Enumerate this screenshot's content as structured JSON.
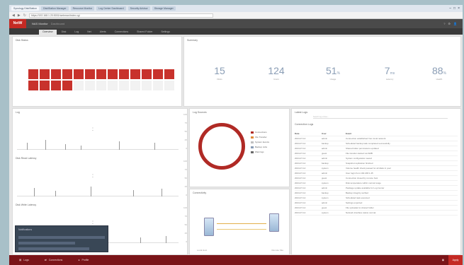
{
  "browser": {
    "tabs": [
      "Synology DiskStation",
      "DiskStation Manager",
      "Resource Monitor",
      "Log Center Dashboard",
      "Security Advisor",
      "Storage Manager"
    ],
    "url": "https://192.168.1.20:5001/webman/index.cgi",
    "controls": [
      "–",
      "□",
      "×"
    ]
  },
  "app": {
    "logo": "NetW",
    "title": "NAS Monitor",
    "subtitle": "Dashboard",
    "header_icons": [
      "?",
      "⚙",
      "👤"
    ],
    "nav_tabs": [
      "Overview",
      "Disk",
      "Log",
      "Net",
      "Alerts",
      "Connections",
      "Shared Folder",
      "Settings"
    ]
  },
  "panels": {
    "disks_title": "Disk Status",
    "summary_title": "Summary",
    "stats": [
      {
        "num": "15",
        "unit": "",
        "label": "Disks"
      },
      {
        "num": "124",
        "unit": "",
        "label": "Users"
      },
      {
        "num": "51",
        "unit": "%",
        "label": "Usage"
      },
      {
        "num": "7",
        "unit": "ms",
        "label": "Latency"
      },
      {
        "num": "88",
        "unit": "%",
        "label": "Health"
      }
    ],
    "chart1_title": "Log",
    "chart2_title": "Disk Read Latency",
    "chart3_title": "Disk Write Latency",
    "donut_title": "Log Sources",
    "legend": [
      {
        "label": "Connections",
        "color": "#b02a25"
      },
      {
        "label": "File Transfer",
        "color": "#e08a3a"
      },
      {
        "label": "System Events",
        "color": "#c0c0c0"
      },
      {
        "label": "Backup Jobs",
        "color": "#8a9db5"
      },
      {
        "label": "Warnings",
        "color": "#6a6a6a"
      }
    ],
    "topology_title": "Connectivity",
    "topology_left": "Local Host",
    "topology_right": "Remote Site",
    "log_title": "Latest Logs",
    "log_filter": "Search log entries...",
    "log_subtitle": "Connection Logs",
    "log_headers": [
      "Date",
      "User",
      "Event"
    ],
    "log_rows": [
      [
        "2024-07-12",
        "admin",
        "Connection established from local network"
      ],
      [
        "2024-07-12",
        "backup",
        "Scheduled backup task completed successfully"
      ],
      [
        "2024-07-12",
        "admin",
        "Shared folder permissions updated"
      ],
      [
        "2024-07-12",
        "guest",
        "File transfer started via SMB"
      ],
      [
        "2024-07-12",
        "admin",
        "System configuration saved"
      ],
      [
        "2024-07-12",
        "backup",
        "Snapshot replication finished"
      ],
      [
        "2024-07-12",
        "system",
        "Volume health check passed for all disks in pool"
      ],
      [
        "2024-07-12",
        "admin",
        "User login from 192.168.1.45"
      ],
      [
        "2024-07-12",
        "guest",
        "Connection closed by remote host"
      ],
      [
        "2024-07-12",
        "system",
        "Disk temperature within normal range"
      ],
      [
        "2024-07-12",
        "admin",
        "Package update available for Log Center"
      ],
      [
        "2024-07-12",
        "backup",
        "Backup integrity verified"
      ],
      [
        "2024-07-12",
        "system",
        "Scheduled task executed"
      ],
      [
        "2024-07-12",
        "admin",
        "Settings exported"
      ],
      [
        "2024-07-12",
        "guest",
        "File uploaded to shared folder"
      ],
      [
        "2024-07-12",
        "system",
        "Network interface status normal"
      ]
    ],
    "popup_title": "Notifications",
    "axis_ticks": [
      "100",
      "75",
      "50",
      "25",
      "0"
    ]
  },
  "statusbar": {
    "items": [
      "Logs",
      "Connections",
      "Profile"
    ],
    "right_btn": "Apply"
  },
  "colors": {
    "accent": "#c42a24",
    "status_bar": "#7a1418",
    "stat_num": "#8a9db5"
  }
}
